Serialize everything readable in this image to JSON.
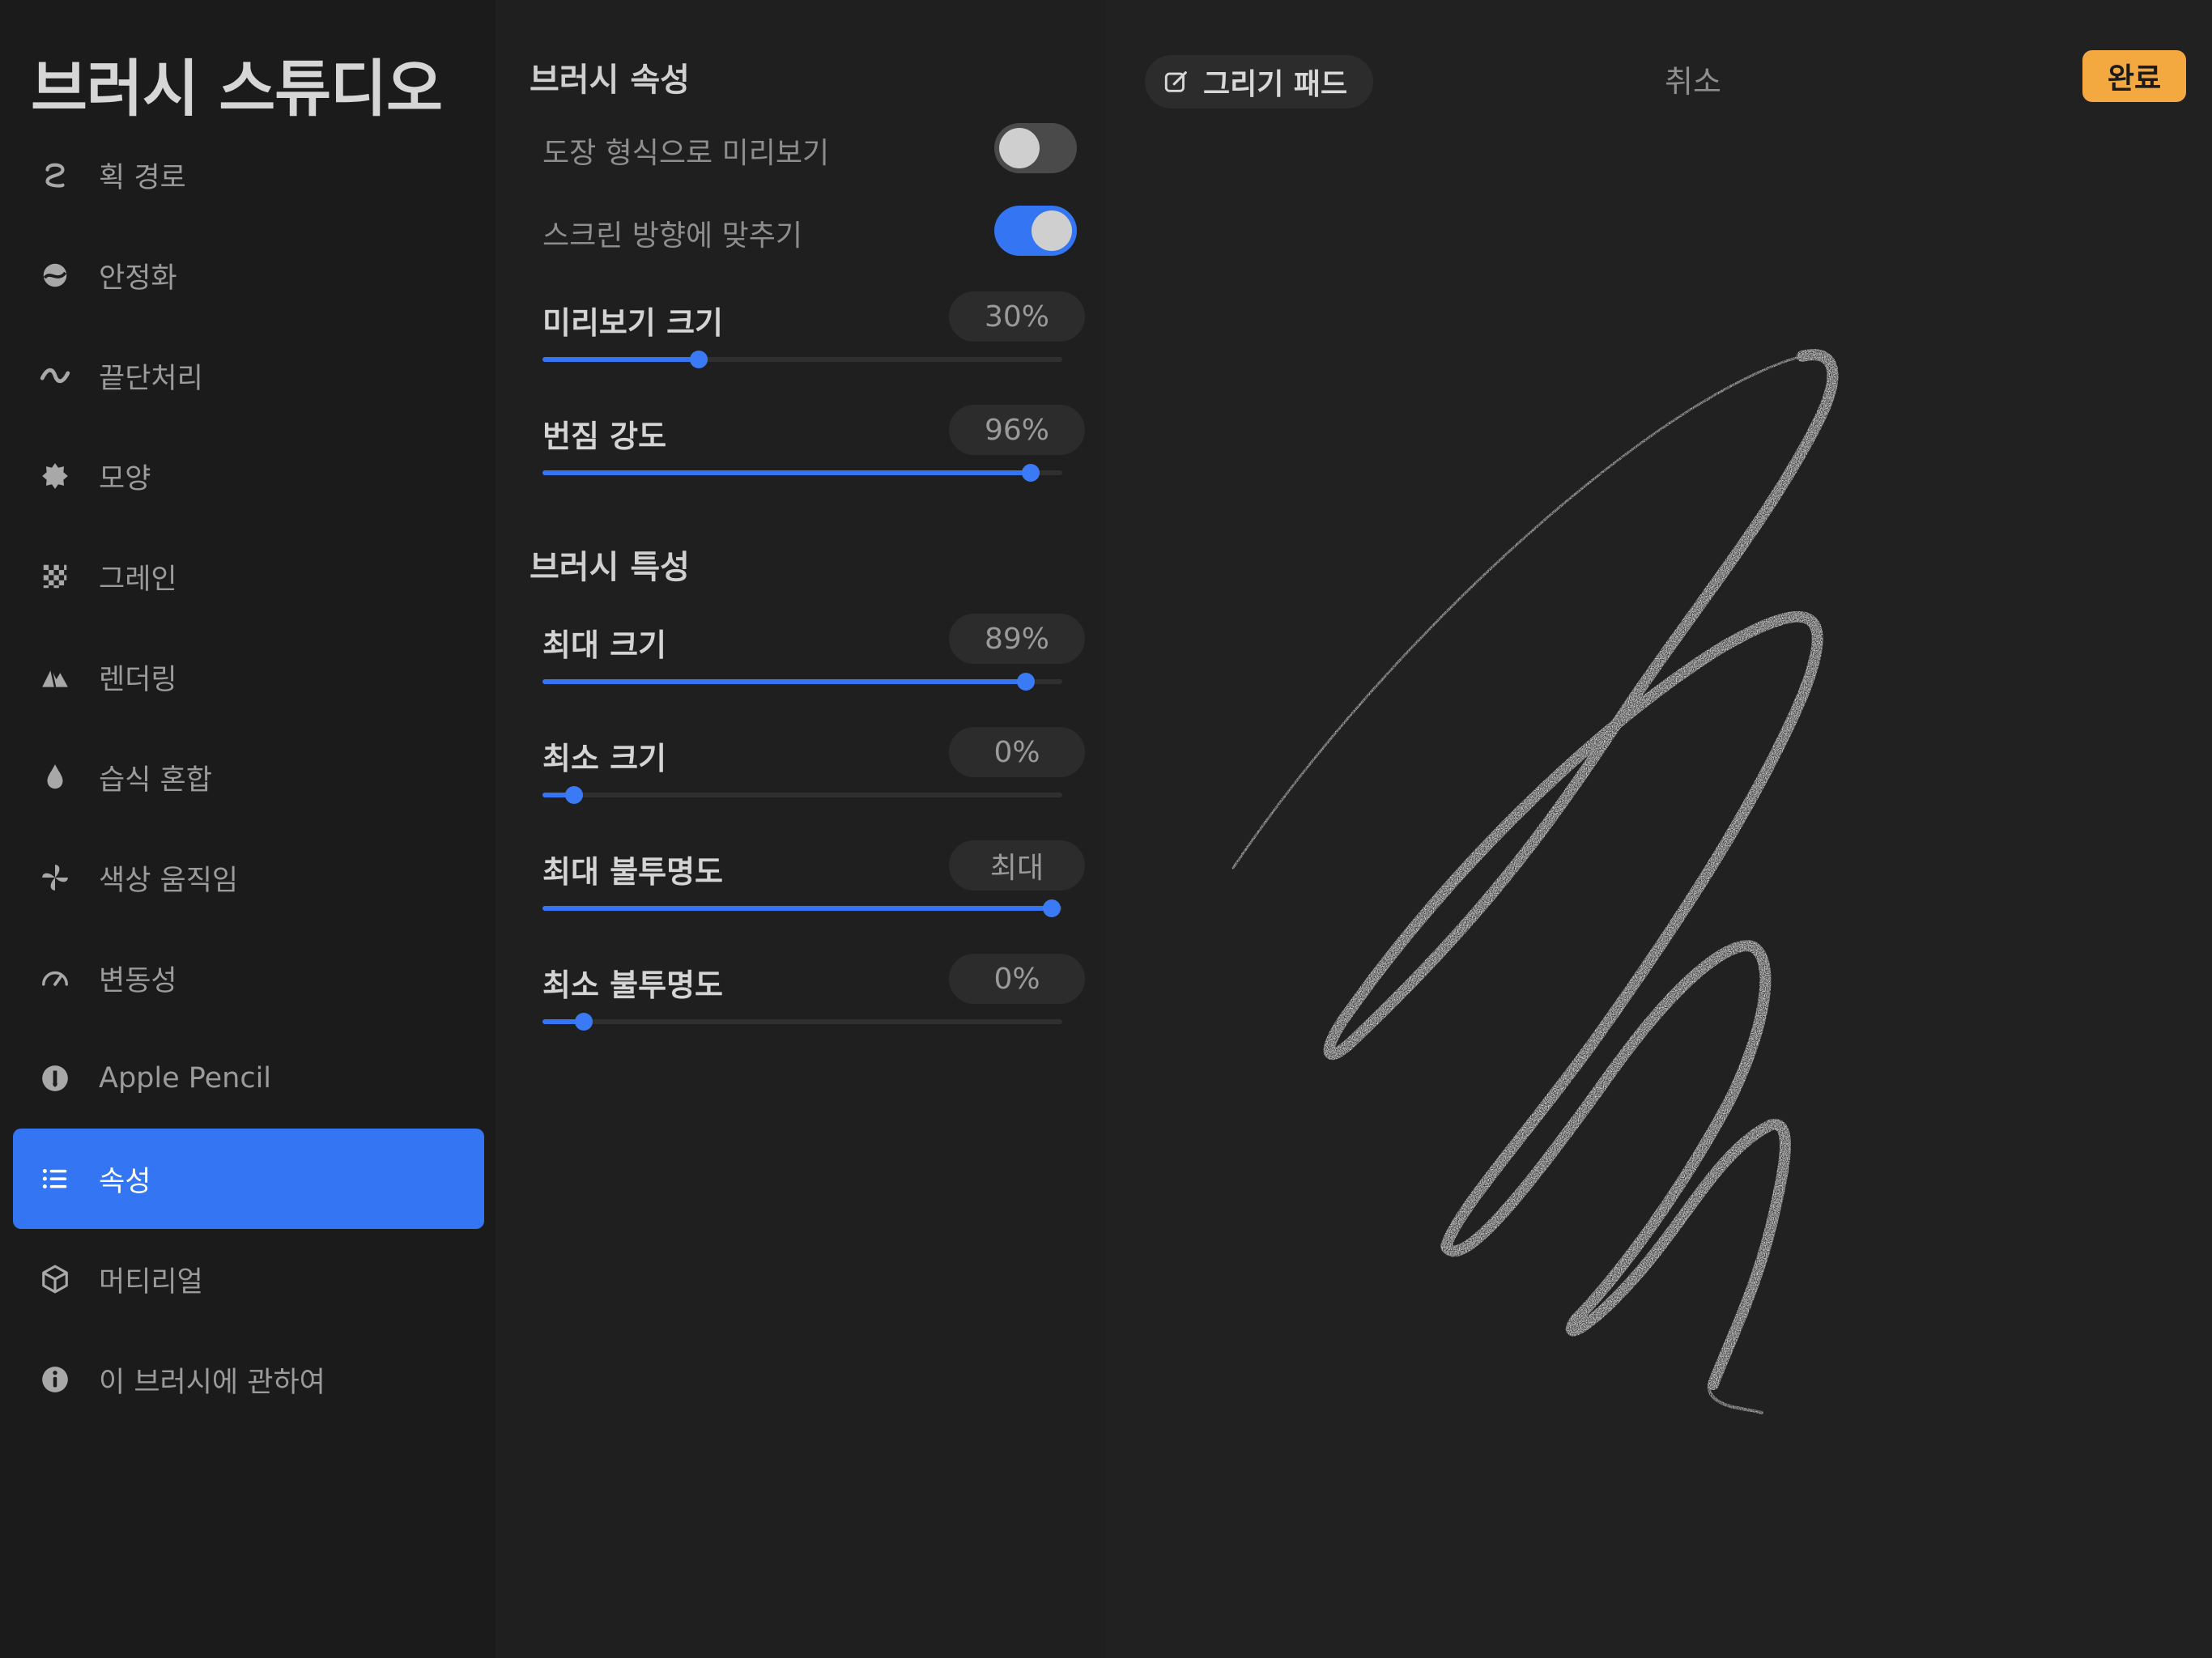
{
  "app_title": "브러시 스튜디오",
  "sidebar": {
    "items": [
      {
        "label": "획 경로",
        "icon": "stroke-path-icon"
      },
      {
        "label": "안정화",
        "icon": "stabilization-icon"
      },
      {
        "label": "끝단처리",
        "icon": "taper-icon"
      },
      {
        "label": "모양",
        "icon": "shape-icon"
      },
      {
        "label": "그레인",
        "icon": "grain-icon"
      },
      {
        "label": "렌더링",
        "icon": "rendering-icon"
      },
      {
        "label": "습식 혼합",
        "icon": "wet-mix-icon"
      },
      {
        "label": "색상 움직임",
        "icon": "color-dynamics-icon"
      },
      {
        "label": "변동성",
        "icon": "dynamics-icon"
      },
      {
        "label": "Apple Pencil",
        "icon": "apple-pencil-icon"
      },
      {
        "label": "속성",
        "icon": "properties-icon",
        "active": true
      },
      {
        "label": "머티리얼",
        "icon": "materials-icon"
      },
      {
        "label": "이 브러시에 관하여",
        "icon": "info-icon"
      }
    ]
  },
  "panel": {
    "brush_properties": {
      "title": "브러시 속성",
      "toggles": [
        {
          "label": "도장 형식으로 미리보기",
          "on": false
        },
        {
          "label": "스크린 방향에 맞추기",
          "on": true
        }
      ],
      "sliders": [
        {
          "label": "미리보기 크기",
          "value": "30%",
          "level": 0.3
        },
        {
          "label": "번짐 강도",
          "value": "96%",
          "level": 0.94
        }
      ]
    },
    "brush_behavior": {
      "title": "브러시 특성",
      "sliders": [
        {
          "label": "최대 크기",
          "value": "89%",
          "level": 0.93
        },
        {
          "label": "최소 크기",
          "value": "0%",
          "level": 0.06
        },
        {
          "label": "최대 불투명도",
          "value": "최대",
          "level": 0.98
        },
        {
          "label": "최소 불투명도",
          "value": "0%",
          "level": 0.08
        }
      ]
    }
  },
  "pad": {
    "title": "그리기 패드",
    "title_icon": "edit-icon",
    "cancel_label": "취소",
    "done_label": "완료"
  },
  "colors": {
    "accent": "#3375f2",
    "done": "#f3a840",
    "stroke": "#e6e6e6"
  }
}
